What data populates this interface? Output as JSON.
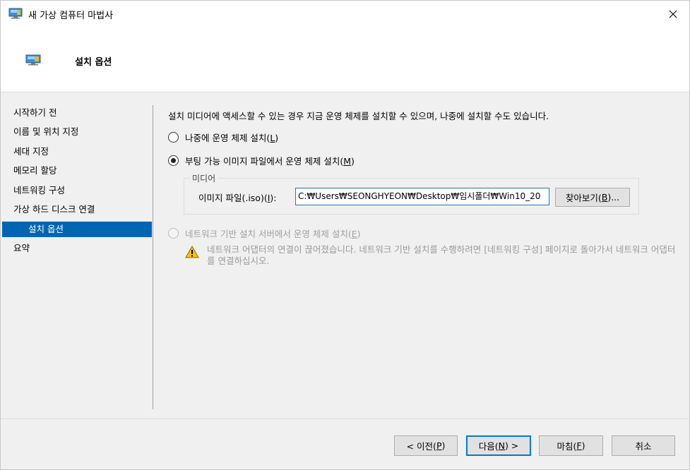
{
  "window": {
    "title": "새 가상 컴퓨터 마법사",
    "header_title": "설치 옵션"
  },
  "sidebar": {
    "items": [
      {
        "label": "시작하기 전"
      },
      {
        "label": "이름 및 위치 지정"
      },
      {
        "label": "세대 지정"
      },
      {
        "label": "메모리 할당"
      },
      {
        "label": "네트워킹 구성"
      },
      {
        "label": "가상 하드 디스크 연결"
      },
      {
        "label": "설치 옵션",
        "active": true
      },
      {
        "label": "요약"
      }
    ]
  },
  "main": {
    "description": "설치 미디어에 액세스할 수 있는 경우 지금 운영 체제를 설치할 수 있으며, 나중에 설치할 수도 있습니다.",
    "option_later": {
      "label": "나중에 운영 체제 설치(",
      "mnemonic": "L",
      "suffix": ")"
    },
    "option_image": {
      "label": "부팅 가능 이미지 파일에서 운영 체제 설치(",
      "mnemonic": "M",
      "suffix": ")"
    },
    "media": {
      "legend": "미디어",
      "iso_label": "이미지 파일(.iso)(",
      "iso_mnemonic": "I",
      "iso_suffix": "):",
      "iso_value": "C:₩Users₩SEONGHYEON₩Desktop₩임시폴더₩Win10_20",
      "browse_label": "찾아보기(",
      "browse_mnemonic": "B",
      "browse_suffix": ")..."
    },
    "option_network": {
      "label": "네트워크 기반 설치 서버에서 운영 체제 설치(",
      "mnemonic": "E",
      "suffix": ")"
    },
    "warning_text": "네트워크 어댑터의 연결이 끊어졌습니다. 네트워크 기반 설치를 수행하려면 [네트워킹 구성] 페이지로 돌아가서 네트워크 어댑터를 연결하십시오."
  },
  "footer": {
    "prev": {
      "label": "< 이전(",
      "mnemonic": "P",
      "suffix": ")"
    },
    "next": {
      "label": "다음(",
      "mnemonic": "N",
      "suffix": ") >"
    },
    "finish": {
      "label": "마침(",
      "mnemonic": "F",
      "suffix": ")"
    },
    "cancel": {
      "label": "취소"
    }
  },
  "colors": {
    "accent": "#0066b4",
    "warning": "#f5c400"
  },
  "icons": {
    "title": "monitor-icon",
    "close": "close-icon",
    "warning": "warning-icon"
  }
}
